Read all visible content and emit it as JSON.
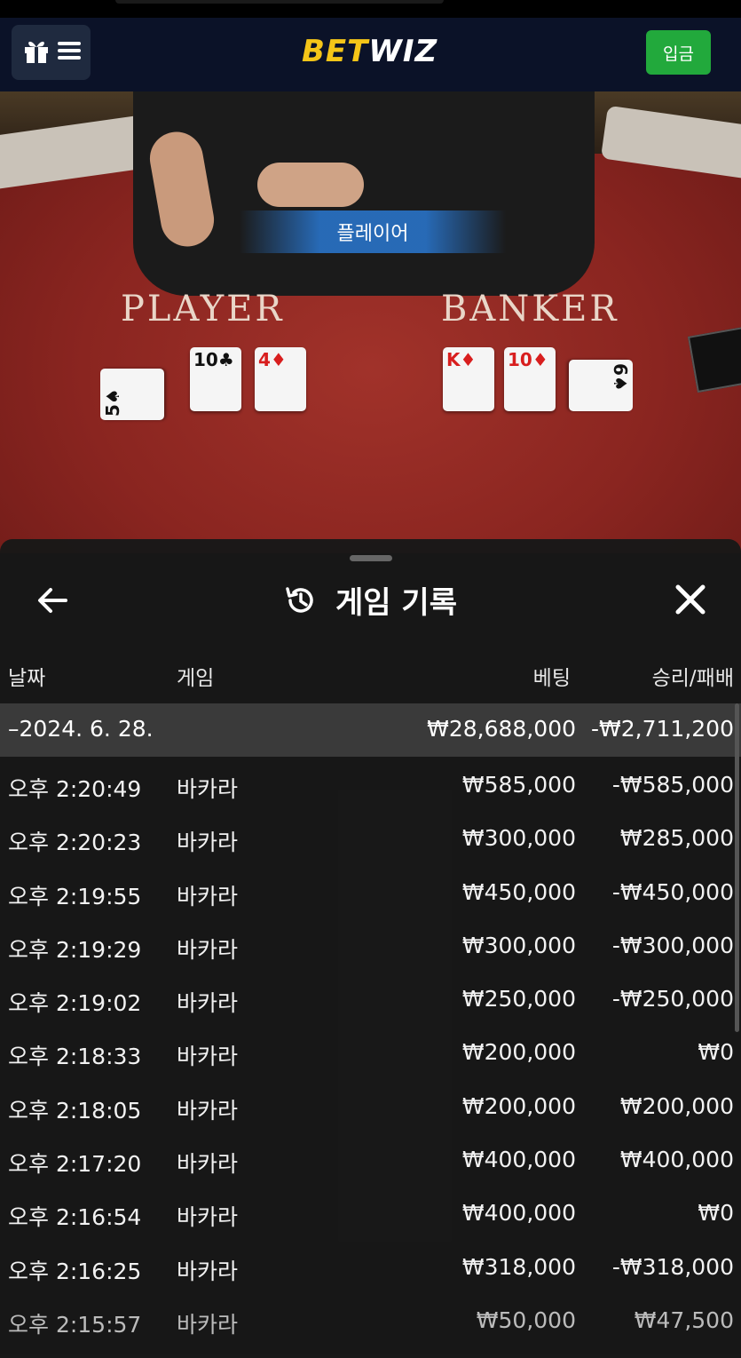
{
  "header": {
    "logo_part1": "BET",
    "logo_part2": "WIZ",
    "deposit_label": "입금"
  },
  "table": {
    "result_banner": "플레이어",
    "player_label": "PLAYER",
    "banker_label": "BANKER",
    "player_cards": [
      {
        "rank": "5",
        "suit": "♠",
        "color": "black"
      },
      {
        "rank": "10",
        "suit": "♣",
        "color": "black"
      },
      {
        "rank": "4",
        "suit": "♦",
        "color": "red"
      }
    ],
    "banker_cards": [
      {
        "rank": "K",
        "suit": "♦",
        "color": "red"
      },
      {
        "rank": "10",
        "suit": "♦",
        "color": "red"
      },
      {
        "rank": "6",
        "suit": "♠",
        "color": "black"
      }
    ]
  },
  "history": {
    "title": "게임 기록",
    "columns": {
      "date": "날짜",
      "game": "게임",
      "bet": "베팅",
      "result": "승리/패배"
    },
    "summary": {
      "date": "–2024. 6. 28.",
      "bet": "₩28,688,000",
      "result": "-₩2,711,200"
    },
    "rows": [
      {
        "time": "오후 2:20:49",
        "game": "바카라",
        "bet": "₩585,000",
        "result": "-₩585,000"
      },
      {
        "time": "오후 2:20:23",
        "game": "바카라",
        "bet": "₩300,000",
        "result": "₩285,000"
      },
      {
        "time": "오후 2:19:55",
        "game": "바카라",
        "bet": "₩450,000",
        "result": "-₩450,000"
      },
      {
        "time": "오후 2:19:29",
        "game": "바카라",
        "bet": "₩300,000",
        "result": "-₩300,000"
      },
      {
        "time": "오후 2:19:02",
        "game": "바카라",
        "bet": "₩250,000",
        "result": "-₩250,000"
      },
      {
        "time": "오후 2:18:33",
        "game": "바카라",
        "bet": "₩200,000",
        "result": "₩0"
      },
      {
        "time": "오후 2:18:05",
        "game": "바카라",
        "bet": "₩200,000",
        "result": "₩200,000"
      },
      {
        "time": "오후 2:17:20",
        "game": "바카라",
        "bet": "₩400,000",
        "result": "₩400,000"
      },
      {
        "time": "오후 2:16:54",
        "game": "바카라",
        "bet": "₩400,000",
        "result": "₩0"
      },
      {
        "time": "오후 2:16:25",
        "game": "바카라",
        "bet": "₩318,000",
        "result": "-₩318,000"
      },
      {
        "time": "오후 2:15:57",
        "game": "바카라",
        "bet": "₩50,000",
        "result": "₩47,500"
      }
    ]
  }
}
